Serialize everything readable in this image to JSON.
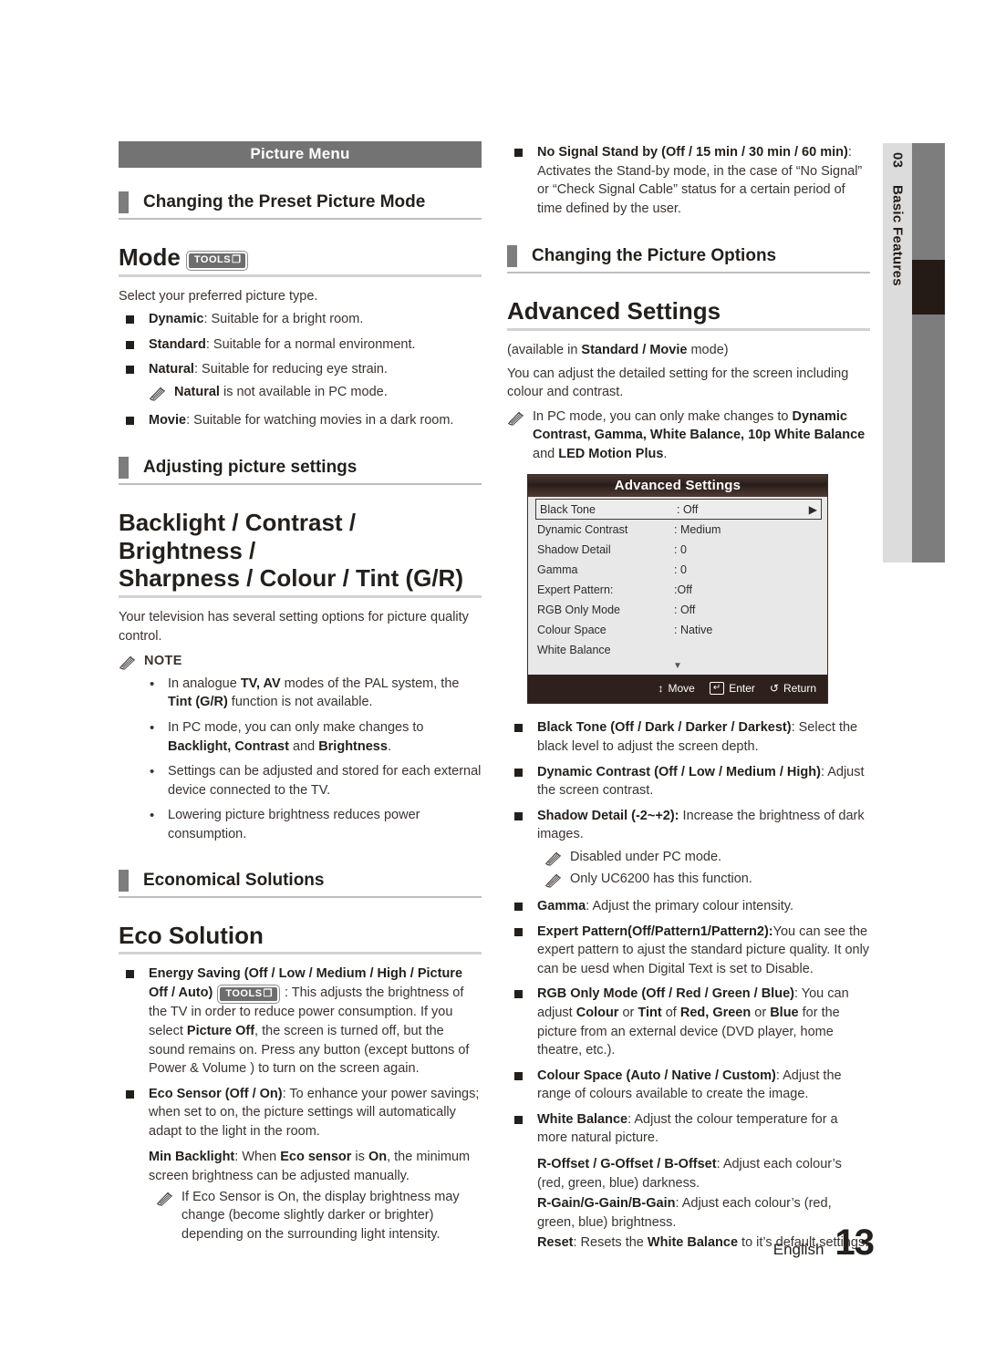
{
  "page": {
    "banner": "Picture Menu",
    "side_tab": {
      "number": "03",
      "label": "Basic Features"
    },
    "footer": {
      "language": "English",
      "page_number": "13"
    },
    "colors": {
      "banner_bg": "#737373",
      "tab_light": "#dcdcdc",
      "tab_dark": "#7d7d7d",
      "tab_marker": "#241a16",
      "heading_square": "#7d7d7d",
      "text": "#3a3330"
    }
  },
  "left": {
    "section1_heading": "Changing the Preset Picture Mode",
    "mode": {
      "title": "Mode",
      "tools_badge": "TOOLS",
      "intro": "Select your preferred picture type.",
      "items": [
        {
          "term": "Dynamic",
          "rest": ": Suitable for a bright room."
        },
        {
          "term": "Standard",
          "rest": ": Suitable for a normal environment."
        },
        {
          "term": "Natural",
          "rest": ": Suitable for reducing eye strain."
        },
        {
          "term": "Movie",
          "rest": ": Suitable for watching movies in a dark room."
        }
      ],
      "natural_note_bold": "Natural",
      "natural_note_rest": " is not available in PC mode."
    },
    "section2_heading": "Adjusting picture settings",
    "backlight": {
      "title_line1": "Backlight / Contrast / Brightness /",
      "title_line2": "Sharpness / Colour / Tint (G/R)",
      "intro": "Your television has several setting options for picture quality control.",
      "note_label": "NOTE",
      "notes": [
        {
          "pre": "In analogue ",
          "b1": "TV, AV",
          "mid": " modes of the PAL system, the ",
          "b2": "Tint (G/R)",
          "post": " function is not available."
        },
        {
          "pre": "In PC mode, you can only make changes to ",
          "b1": "Backlight, Contrast",
          "mid": " and ",
          "b2": "Brightness",
          "post": "."
        },
        {
          "pre": "Settings can be adjusted and stored for each external device connected to the TV.",
          "b1": "",
          "mid": "",
          "b2": "",
          "post": ""
        },
        {
          "pre": "Lowering picture brightness reduces power consumption.",
          "b1": "",
          "mid": "",
          "b2": "",
          "post": ""
        }
      ]
    },
    "section3_heading": "Economical Solutions",
    "eco": {
      "title": "Eco Solution",
      "energy_saving_term": "Energy Saving (Off / Low / Medium / High / Picture Off / Auto)",
      "energy_saving_tools": "TOOLS",
      "energy_saving_body_1": " : This adjusts the brightness of the TV in order to reduce power consumption. If you select  ",
      "energy_saving_bold": "Picture Off",
      "energy_saving_body_2": ", the screen is turned off, but the sound remains on. Press any button (except buttons of Power & Volume ) to turn on the screen again.",
      "eco_sensor_term": "Eco Sensor (Off / On)",
      "eco_sensor_body": ": To enhance your power savings; when set to on, the picture settings will automatically adapt to the light in the room.",
      "min_backlight_term": "Min Backlight",
      "min_backlight_p1": ": When ",
      "min_backlight_b1": "Eco sensor",
      "min_backlight_p2": " is ",
      "min_backlight_b2": "On",
      "min_backlight_p3": ", the minimum screen brightness can be adjusted manually.",
      "eco_note": "If Eco Sensor is On, the display brightness may change (become slightly darker or brighter) depending on the surrounding light intensity."
    }
  },
  "right": {
    "no_signal": {
      "term": "No Signal Stand by (Off / 15 min / 30 min / 60 min)",
      "rest": ": Activates the Stand-by mode, in the case of “No Signal” or “Check Signal Cable” status for a certain period of time defined by the user."
    },
    "section_heading": "Changing the Picture Options",
    "advanced": {
      "title": "Advanced Settings",
      "available_pre": "(available in ",
      "available_bold": "Standard / Movie",
      "available_post": " mode)",
      "intro": "You can adjust the detailed setting for the screen including colour and contrast.",
      "pc_note_pre": "In PC mode, you can only make changes to ",
      "pc_note_bold": "Dynamic Contrast, Gamma, White Balance, 10p White Balance",
      "pc_note_mid": " and ",
      "pc_note_bold2": "LED Motion Plus",
      "pc_note_post": "."
    },
    "osd": {
      "title": "Advanced Settings",
      "rows": [
        {
          "label": "Black Tone",
          "value": ": Off",
          "selected": true,
          "arrow": "▶"
        },
        {
          "label": "Dynamic Contrast",
          "value": ": Medium",
          "selected": false,
          "arrow": ""
        },
        {
          "label": "Shadow Detail",
          "value": ": 0",
          "selected": false,
          "arrow": ""
        },
        {
          "label": "Gamma",
          "value": ": 0",
          "selected": false,
          "arrow": ""
        },
        {
          "label": "Expert Pattern:",
          "value": ":Off",
          "selected": false,
          "arrow": ""
        },
        {
          "label": "RGB Only Mode",
          "value": ": Off",
          "selected": false,
          "arrow": ""
        },
        {
          "label": "Colour Space",
          "value": ": Native",
          "selected": false,
          "arrow": ""
        },
        {
          "label": "White Balance",
          "value": "",
          "selected": false,
          "arrow": ""
        }
      ],
      "scroll_caret": "▼",
      "footer": [
        {
          "icon": "↕",
          "label": "Move"
        },
        {
          "icon": "↵",
          "label": "Enter"
        },
        {
          "icon": "↺",
          "label": "Return"
        }
      ]
    },
    "options": [
      {
        "term": "Black Tone (Off / Dark / Darker / Darkest)",
        "rest": ": Select the black level to adjust the screen depth."
      },
      {
        "term": "Dynamic Contrast (Off / Low / Medium / High)",
        "rest": ": Adjust the screen contrast."
      },
      {
        "term": "Shadow Detail (-2~+2):",
        "rest": " Increase the brightness of dark images."
      },
      {
        "term": "Gamma",
        "rest": ": Adjust the primary colour intensity."
      },
      {
        "term": "Expert Pattern(Off/Pattern1/Pattern2):",
        "rest": "You can see the expert pattern to ajust the standard picture quality. It only can be uesd when Digital Text is set to Disable."
      }
    ],
    "shadow_notes": [
      "Disabled under PC mode.",
      "Only UC6200 has this function."
    ],
    "rgb": {
      "term": "RGB Only Mode (Off / Red / Green / Blue)",
      "p1": ": You can adjust ",
      "b1": "Colour",
      "p2": " or ",
      "b2": "Tint",
      "p3": " of ",
      "b3": "Red, Green",
      "p4": " or ",
      "b4": "Blue",
      "p5": " for the picture from an external device (DVD player, home theatre, etc.)."
    },
    "colour_space": {
      "term": "Colour Space (Auto / Native / Custom)",
      "rest": ": Adjust the range of colours available to create the image."
    },
    "white_balance": {
      "term": "White Balance",
      "rest": ": Adjust the colour temperature for a more natural picture."
    },
    "offsets": {
      "term": "R-Offset / G-Offset / B-Offset",
      "rest": ": Adjust each colour’s (red, green, blue) darkness."
    },
    "gains": {
      "term": "R-Gain/G-Gain/B-Gain",
      "rest": ": Adjust each colour’s (red, green, blue) brightness."
    },
    "reset": {
      "term": "Reset",
      "p1": ": Resets the ",
      "b1": "White Balance",
      "p2": " to it’s default settings."
    }
  }
}
